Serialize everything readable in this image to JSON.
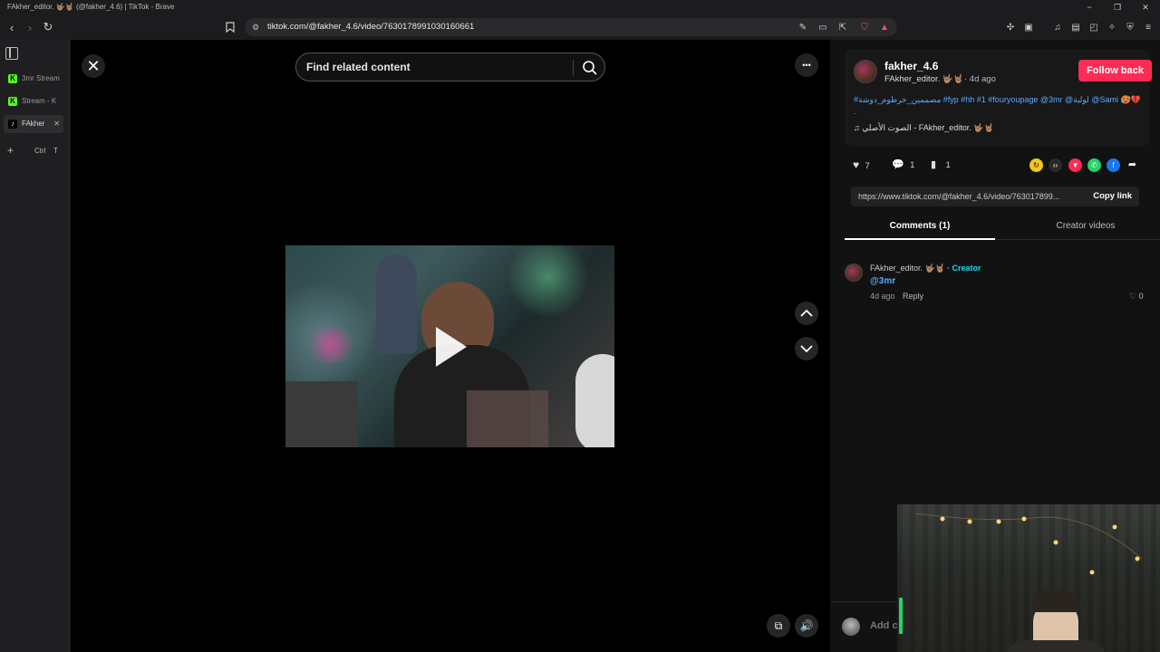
{
  "window": {
    "title": "FAkher_editor. 🤟🏽🤘🏽 (@fakher_4.6) | TikTok - Brave",
    "controls": [
      "−",
      "❐",
      "✕"
    ]
  },
  "browser": {
    "url": "tiktok.com/@fakher_4.6/video/7630178991030160661",
    "icons": [
      "back-icon",
      "forward-icon",
      "reload-icon",
      "bookmark-icon",
      "tune-icon",
      "translate-icon",
      "cast-icon",
      "share-icon",
      "brave-shields-icon",
      "brave-rewards-icon",
      "extensions-icon",
      "sidepanel-icon",
      "music-icon",
      "reader-icon",
      "wallet-icon",
      "leo-icon",
      "vpn-icon",
      "menu-icon"
    ]
  },
  "sidebar": {
    "tabs": [
      {
        "label": "3mr Stream",
        "color": "#53fc18",
        "glyph": "K"
      },
      {
        "label": "Stream - K",
        "color": "#53fc18",
        "glyph": "K"
      },
      {
        "label": "FAkher",
        "color": "#000000",
        "glyph": "♪"
      }
    ],
    "new_tab": {
      "plus": "+",
      "shortcut_ctrl": "Ctrl",
      "shortcut_key": "T"
    }
  },
  "player": {
    "search_placeholder": "Find related content",
    "more_label": "•••"
  },
  "post": {
    "username": "fakher_4.6",
    "display_name": "FAkher_editor. 🤟🏽🤘🏽",
    "age": "· 4d ago",
    "follow_label": "Follow back",
    "caption": "#مصممين_خرطوم_دوشة #fyp #hh #1 #fouryoupage @3mr @لولبة @Sami 🥵💔 .",
    "sound": "الصوت الأصلي - FAkher_editor. 🤟🏽🤘🏽",
    "likes": "7",
    "comments": "1",
    "saves": "1",
    "link": "https://www.tiktok.com/@fakher_4.6/video/763017899...",
    "copy_label": "Copy link"
  },
  "tabs": {
    "comments": "Comments (1)",
    "creator": "Creator videos"
  },
  "comment": {
    "author": "FAkher_editor. 🤟🏽🤘🏽",
    "badge": "· Creator",
    "text": "@3mr",
    "age": "4d ago",
    "reply": "Reply",
    "likes": "0"
  },
  "add_comment": {
    "placeholder": "Add c"
  },
  "colors": {
    "accent": "#fe2c55",
    "link": "#5ea9ff",
    "creator": "#20d5ec"
  }
}
